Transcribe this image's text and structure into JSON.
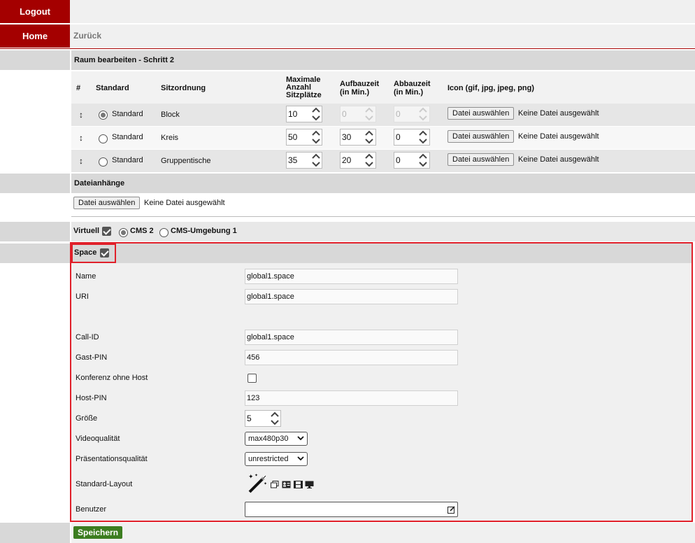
{
  "nav": {
    "logout": "Logout",
    "home": "Home",
    "back": "Zurück"
  },
  "section_title": "Raum bearbeiten - Schritt 2",
  "table": {
    "headers": {
      "hash": "#",
      "standard": "Standard",
      "seating": "Sitzordnung",
      "max_seats_1": "Maximale",
      "max_seats_2": "Anzahl",
      "max_seats_3": "Sitzplätze",
      "setup_1": "Aufbauzeit",
      "setup_2": "(in Min.)",
      "teardown_1": "Abbauzeit",
      "teardown_2": "(in Min.)",
      "icon": "Icon (gif, jpg, jpeg, png)"
    },
    "rows": [
      {
        "drag": "↕",
        "standard_label": "Standard",
        "seating": "Block",
        "max": "10",
        "setup": "0",
        "teardown": "0",
        "file_button": "Datei auswählen",
        "file_status": "Keine Datei ausgewählt"
      },
      {
        "drag": "↕",
        "standard_label": "Standard",
        "seating": "Kreis",
        "max": "50",
        "setup": "30",
        "teardown": "0",
        "file_button": "Datei auswählen",
        "file_status": "Keine Datei ausgewählt"
      },
      {
        "drag": "↕",
        "standard_label": "Standard",
        "seating": "Gruppentische",
        "max": "35",
        "setup": "20",
        "teardown": "0",
        "file_button": "Datei auswählen",
        "file_status": "Keine Datei ausgewählt"
      }
    ]
  },
  "attachments": {
    "title": "Dateianhänge",
    "file_button": "Datei auswählen",
    "file_status": "Keine Datei ausgewählt"
  },
  "virtual": {
    "label": "Virtuell",
    "option1": "CMS 2",
    "option2": "CMS-Umgebung 1"
  },
  "space": {
    "label": "Space",
    "name_label": "Name",
    "name_value": "global1.space",
    "uri_label": "URI",
    "uri_value": "global1.space",
    "callid_label": "Call-ID",
    "callid_value": "global1.space",
    "guestpin_label": "Gast-PIN",
    "guestpin_value": "456",
    "nohost_label": "Konferenz ohne Host",
    "hostpin_label": "Host-PIN",
    "hostpin_value": "123",
    "size_label": "Größe",
    "size_value": "5",
    "video_label": "Videoqualität",
    "video_value": "max480p30",
    "presentation_label": "Präsentationsqualität",
    "presentation_value": "unrestricted",
    "layout_label": "Standard-Layout",
    "users_label": "Benutzer"
  },
  "save_button": "Speichern",
  "colors": {
    "brand_red": "#a40000",
    "highlight": "#e0202a",
    "save_green": "#3c7d20"
  }
}
